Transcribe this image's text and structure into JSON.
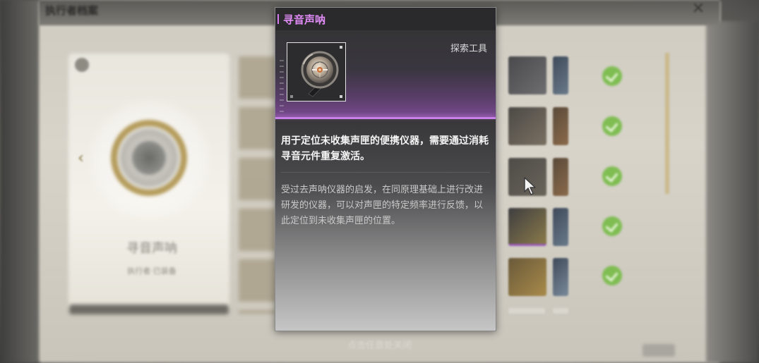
{
  "background": {
    "window_title": "执行者档案",
    "close_icon": "close-icon",
    "left_card": {
      "item_name": "寻音声呐",
      "item_sub": "执行者·已装备"
    },
    "status_icon": "check-icon",
    "hint": "点击任意处关闭"
  },
  "tooltip": {
    "title": "寻音声呐",
    "category": "探索工具",
    "icon": "sonar-device-icon",
    "summary": "用于定位未收集声匣的便携仪器，需要通过消耗寻音元件重复激活。",
    "description": "受过去声呐仪器的启发，在同原理基础上进行改进研发的仪器，可以对声匣的特定频率进行反馈，以此定位到未收集声匣的位置。",
    "accent_color": "#d77cf2"
  }
}
